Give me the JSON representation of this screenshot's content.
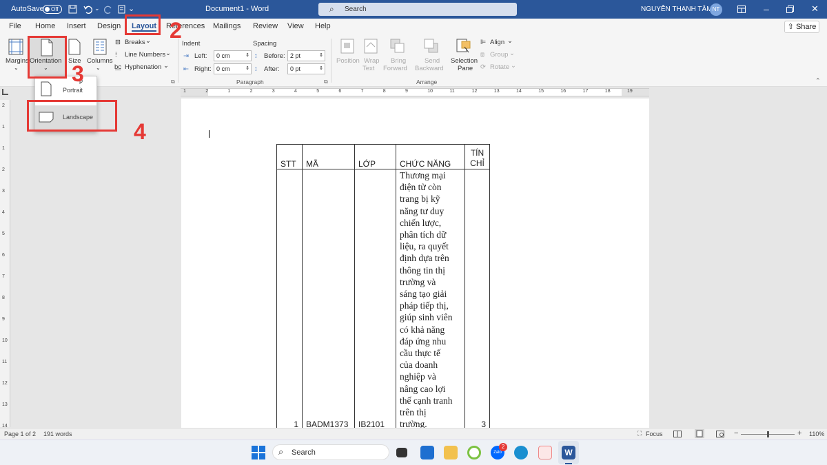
{
  "titlebar": {
    "autosave_label": "AutoSave",
    "autosave_state": "Off",
    "document_title": "Document1  -  Word",
    "search_placeholder": "Search",
    "user_name": "NGUYỄN THANH TÂM",
    "user_initials": "NT"
  },
  "menu": {
    "tabs": [
      "File",
      "Home",
      "Insert",
      "Design",
      "Layout",
      "References",
      "Mailings",
      "Review",
      "View",
      "Help"
    ],
    "active_tab": "Layout",
    "share_label": "Share"
  },
  "ribbon": {
    "page_setup": {
      "margins": "Margins",
      "orientation": "Orientation",
      "size": "Size",
      "columns": "Columns",
      "breaks": "Breaks",
      "line_numbers": "Line Numbers",
      "hyphenation": "Hyphenation"
    },
    "paragraph": {
      "indent_header": "Indent",
      "spacing_header": "Spacing",
      "left_label": "Left:",
      "left_value": "0 cm",
      "right_label": "Right:",
      "right_value": "0 cm",
      "before_label": "Before:",
      "before_value": "2 pt",
      "after_label": "After:",
      "after_value": "0 pt",
      "group_label": "Paragraph"
    },
    "arrange": {
      "position": "Position",
      "wrap": "Wrap",
      "wrap2": "Text",
      "bring": "Bring",
      "bring2": "Forward",
      "send": "Send",
      "send2": "Backward",
      "selection": "Selection",
      "selection2": "Pane",
      "align": "Align",
      "group": "Group",
      "rotate": "Rotate",
      "group_label": "Arrange"
    }
  },
  "orientation_menu": {
    "portrait": "Portrait",
    "landscape": "Landscape"
  },
  "annotations": {
    "step2": "2",
    "step3": "3",
    "step4": "4",
    "color": "#e53935"
  },
  "ruler": {
    "marks": [
      "1",
      "2",
      "1",
      "2",
      "3",
      "4",
      "5",
      "6",
      "7",
      "8",
      "9",
      "10",
      "11",
      "12",
      "13",
      "14",
      "15",
      "16",
      "17",
      "18",
      "19"
    ]
  },
  "vruler": {
    "marks": [
      "2",
      "1",
      "1",
      "2",
      "3",
      "4",
      "5",
      "6",
      "7",
      "8",
      "9",
      "10",
      "11",
      "12",
      "13",
      "14"
    ]
  },
  "table": {
    "headers": [
      "STT",
      "MÃ",
      "LỚP",
      "CHỨC NĂNG",
      "TÍN CHỈ"
    ],
    "header_tin": "TÍN",
    "header_chi": "CHỈ",
    "row": {
      "stt": "1",
      "ma": "BADM1373",
      "lop": "IB2101",
      "desc_lines": [
        "Thương mại",
        "điện tử còn",
        "trang bị kỹ",
        "năng tư duy",
        "chiến lược,",
        "phân tích dữ",
        "liệu, ra quyết",
        "định dựa trên",
        "thông tin thị",
        "trường và",
        "sáng tạo giải",
        "pháp tiếp thị,",
        "giúp sinh viên",
        "có khả năng",
        "đáp ứng nhu",
        "cầu thực tế",
        "của doanh",
        "nghiệp và",
        "nâng cao lợi",
        "thế cạnh tranh",
        "trên thị",
        "trường."
      ],
      "tin_chi": "3"
    }
  },
  "status": {
    "page": "Page 1 of 2",
    "words": "191 words",
    "focus": "Focus",
    "zoom": "110%",
    "minus": "−",
    "plus": "+"
  },
  "taskbar": {
    "search_placeholder": "Search",
    "badge": "2",
    "zalo": "Zalo"
  }
}
